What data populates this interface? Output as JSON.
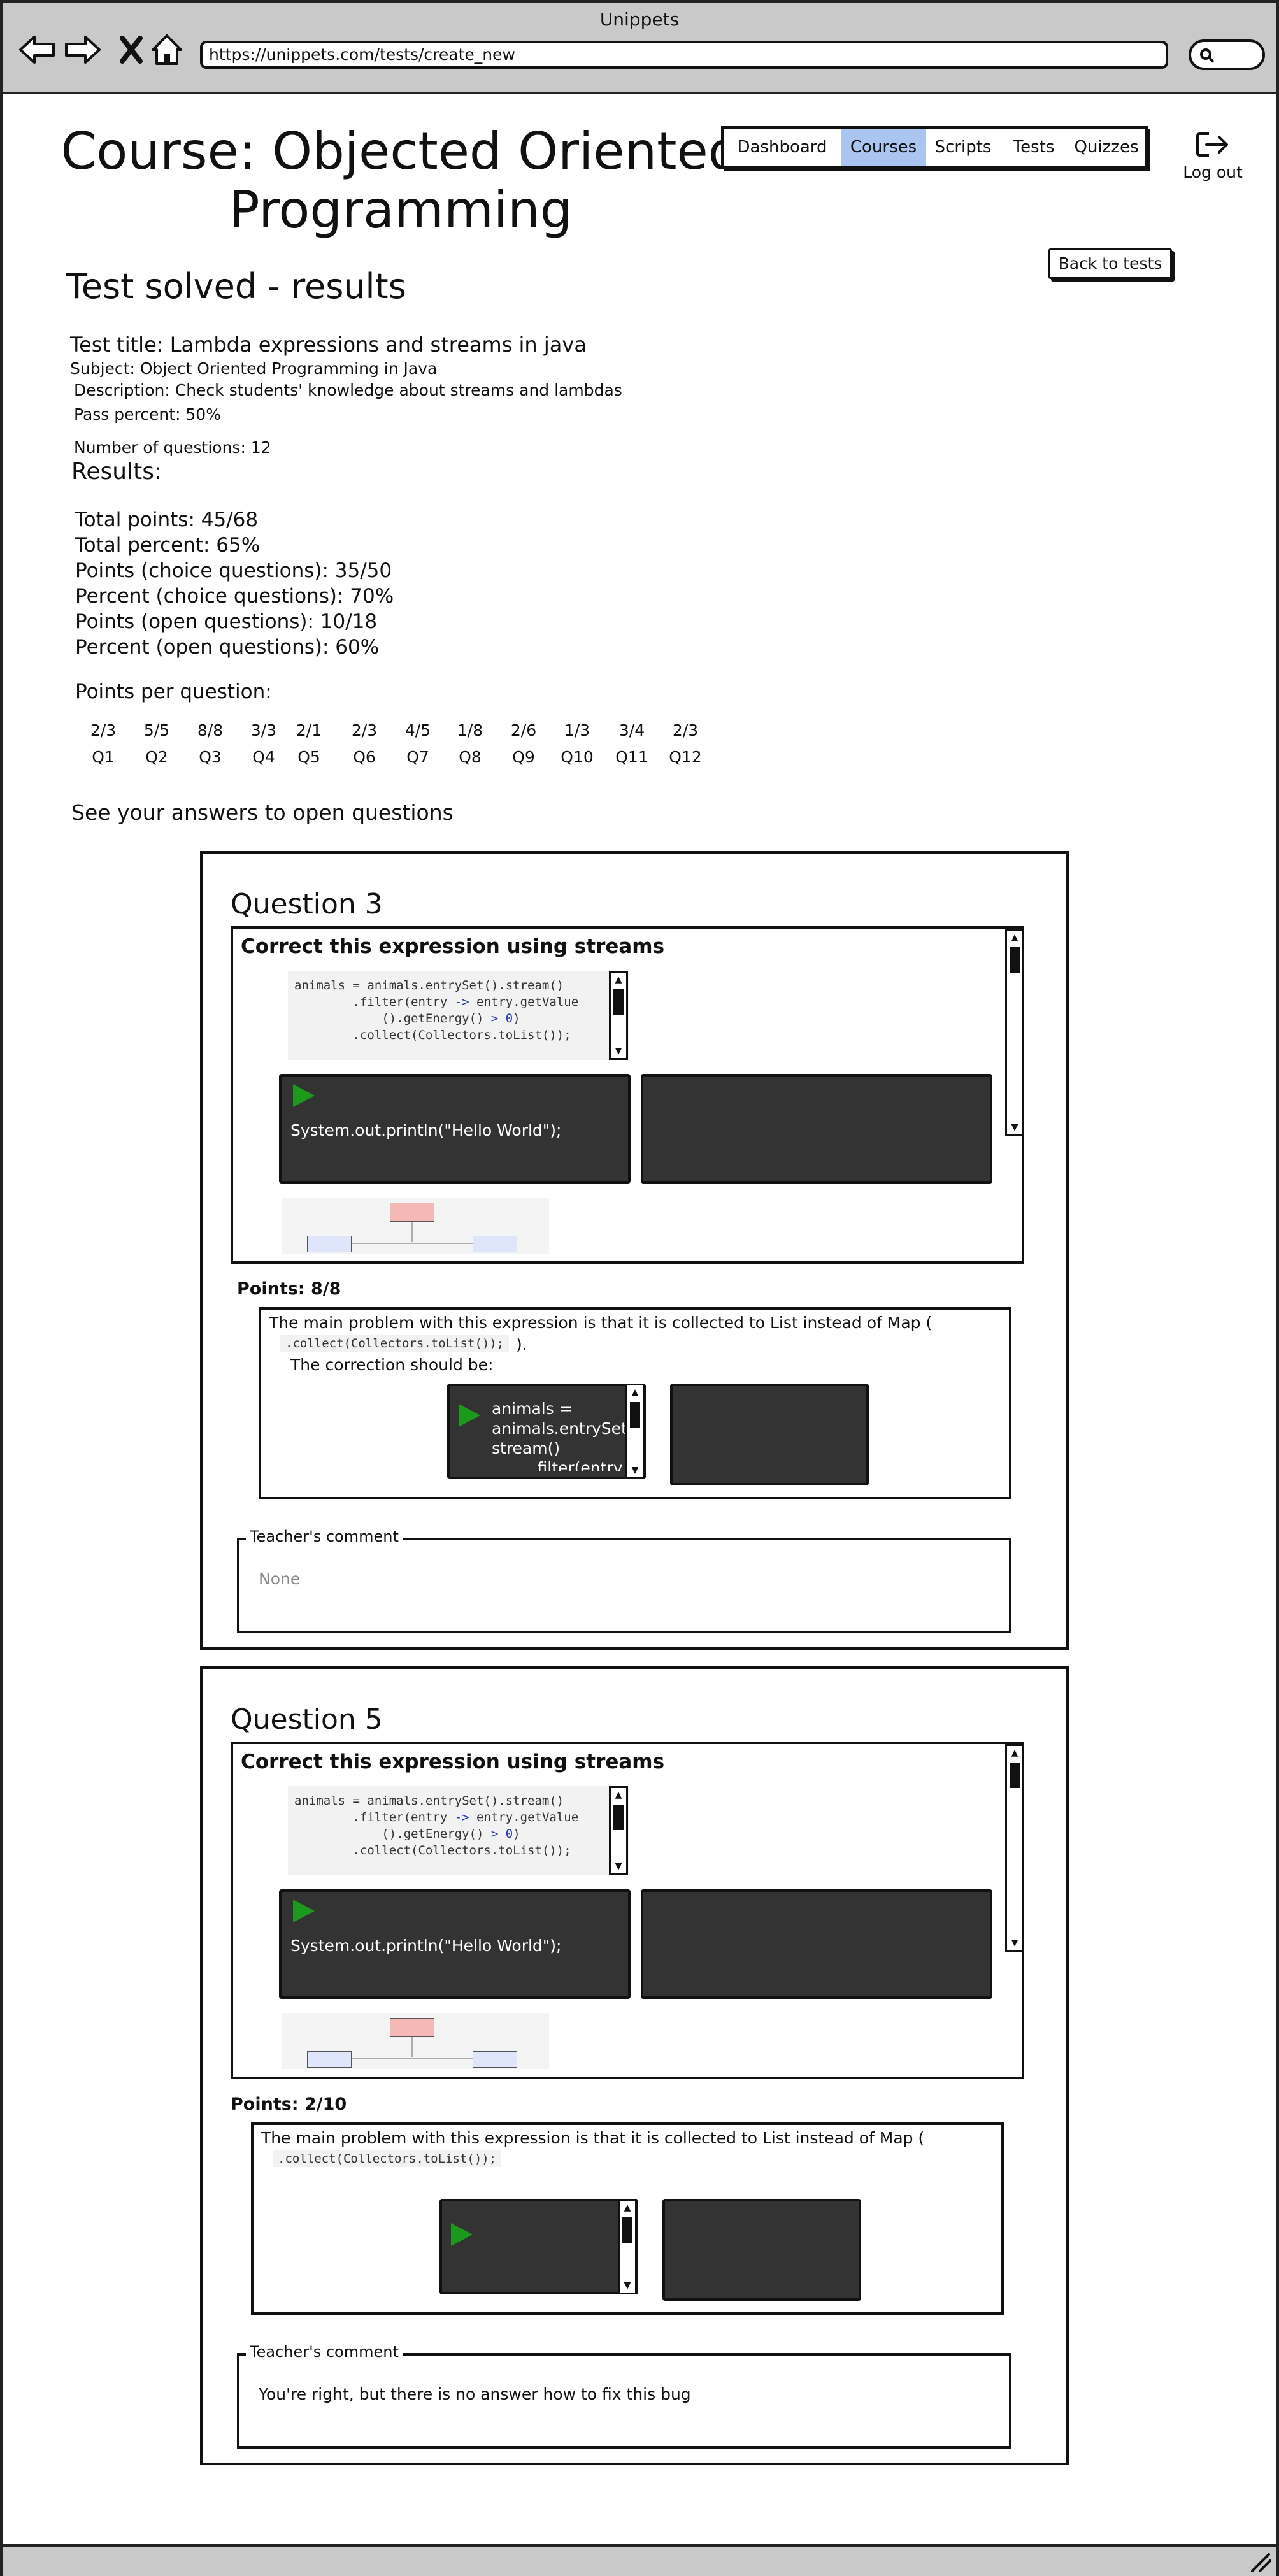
{
  "browser": {
    "title": "Unippets",
    "url": "https://unippets.com/tests/create_new"
  },
  "header": {
    "course_title": "Course: Objected Oriented Programming",
    "nav": [
      "Dashboard",
      "Courses",
      "Scripts",
      "Tests",
      "Quizzes"
    ],
    "active_nav": "Courses",
    "logout_label": "Log out",
    "back_button": "Back to tests",
    "accent_color": "#a9c5f0"
  },
  "test": {
    "heading": "Test solved - results",
    "title": "Test title: Lambda expressions and streams in java",
    "subject": "Subject: Object Oriented Programming in Java",
    "description": "Description: Check students' knowledge about streams and lambdas",
    "pass_percent": "Pass percent: 50%",
    "num_questions": "Number of questions: 12"
  },
  "results": {
    "heading": "Results:",
    "total_points": "Total points: 45/68",
    "total_percent": "Total percent: 65%",
    "choice_points": "Points (choice questions): 35/50",
    "choice_percent": "Percent (choice questions): 70%",
    "open_points": "Points (open questions): 10/18",
    "open_percent": "Percent (open questions): 60%"
  },
  "points_per_question": {
    "heading": "Points per question:",
    "items": [
      {
        "score": "2/3",
        "q": "Q1"
      },
      {
        "score": "5/5",
        "q": "Q2"
      },
      {
        "score": "8/8",
        "q": "Q3"
      },
      {
        "score": "3/3",
        "q": "Q4"
      },
      {
        "score": "2/1",
        "q": "Q5"
      },
      {
        "score": "2/3",
        "q": "Q6"
      },
      {
        "score": "4/5",
        "q": "Q7"
      },
      {
        "score": "1/8",
        "q": "Q8"
      },
      {
        "score": "2/6",
        "q": "Q9"
      },
      {
        "score": "1/3",
        "q": "Q10"
      },
      {
        "score": "3/4",
        "q": "Q11"
      },
      {
        "score": "2/3",
        "q": "Q12"
      }
    ]
  },
  "open_questions_heading": "See your answers to open questions",
  "questions": [
    {
      "title": "Question 3",
      "prompt": "Correct this expression using streams",
      "code": "animals = animals.entrySet().stream()",
      "hello": "System.out.println(\"Hello World\");",
      "points": "Points: 8/8",
      "answer_line1": "The main problem with this expression is that it is collected to List instead of Map (",
      "answer_code": ".collect(Collectors.toList());",
      "answer_after": ").",
      "answer_line2": "The correction should be:",
      "answer_editor": "animals =\nanimals.entrySet().\nstream()\n        .filter(entry",
      "comment_label": "Teacher's comment",
      "comment": "None"
    },
    {
      "title": "Question 5",
      "prompt": "Correct this expression using streams",
      "code": "animals = animals.entrySet().stream()",
      "hello": "System.out.println(\"Hello World\");",
      "points": "Points: 2/10",
      "answer_line1": "The main problem with this expression is that it is collected to List instead of Map (",
      "answer_code": ".collect(Collectors.toList());",
      "comment_label": "Teacher's comment",
      "comment": "You're right, but there is no answer how to fix this bug"
    }
  ],
  "icons": [
    "back-arrow-icon",
    "forward-arrow-icon",
    "close-icon",
    "home-icon",
    "search-icon",
    "logout-icon",
    "play-icon",
    "resize-grip-icon"
  ]
}
